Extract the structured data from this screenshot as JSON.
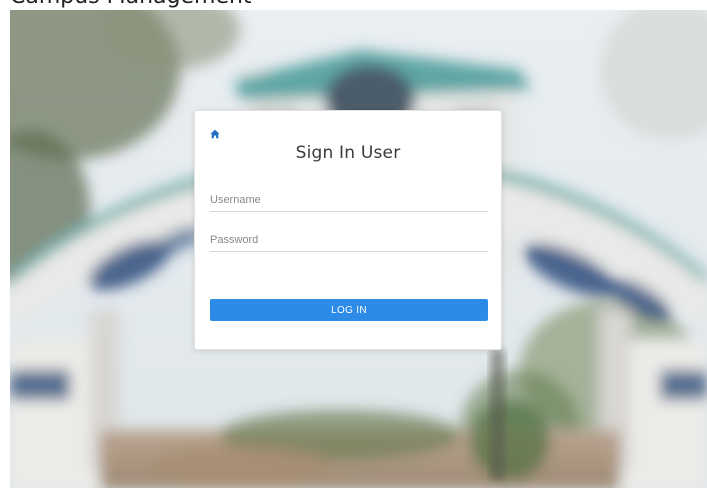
{
  "header": {
    "clipped_text": "Campus Management"
  },
  "login": {
    "title": "Sign In User",
    "username_placeholder": "Username",
    "password_placeholder": "Password",
    "submit_label": "LOG IN",
    "accent_color": "#2c8be6"
  },
  "icons": {
    "home": "home-icon"
  }
}
